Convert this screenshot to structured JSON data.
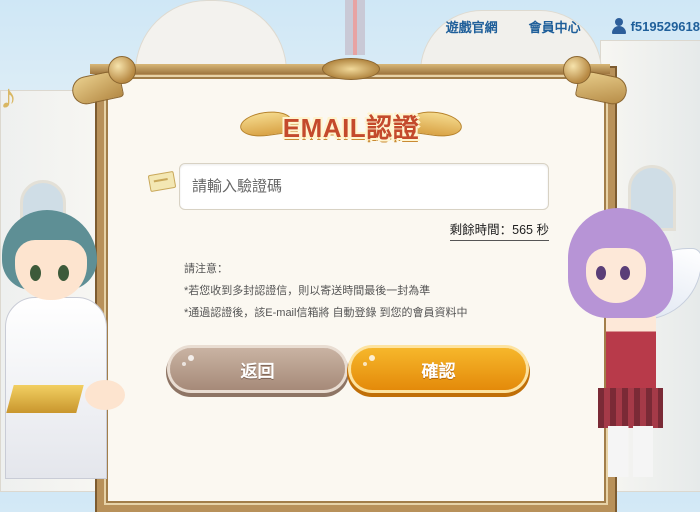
{
  "topnav": {
    "official_site": "遊戲官網",
    "member_center": "會員中心",
    "username": "f519529618"
  },
  "title": "EMAIL認證",
  "verification": {
    "placeholder": "請輸入驗證碼",
    "value": "",
    "timer_label": "剩餘時間：",
    "timer_value": "565 秒"
  },
  "notes": {
    "heading": "請注意：",
    "line1": "*若您收到多封認證信，則以寄送時間最後一封為準",
    "line2": "*通過認證後，該E-mail信箱將 自動登錄 到您的會員資料中"
  },
  "buttons": {
    "back": "返回",
    "confirm": "確認"
  },
  "colors": {
    "nav_link": "#1f5f9a",
    "title": "#c44a2c",
    "back_button": "#a68a79",
    "confirm_button": "#e48a0a",
    "frame": "#b8915a"
  },
  "icons": [
    "user-icon",
    "ticket-icon",
    "music-note-icon"
  ]
}
